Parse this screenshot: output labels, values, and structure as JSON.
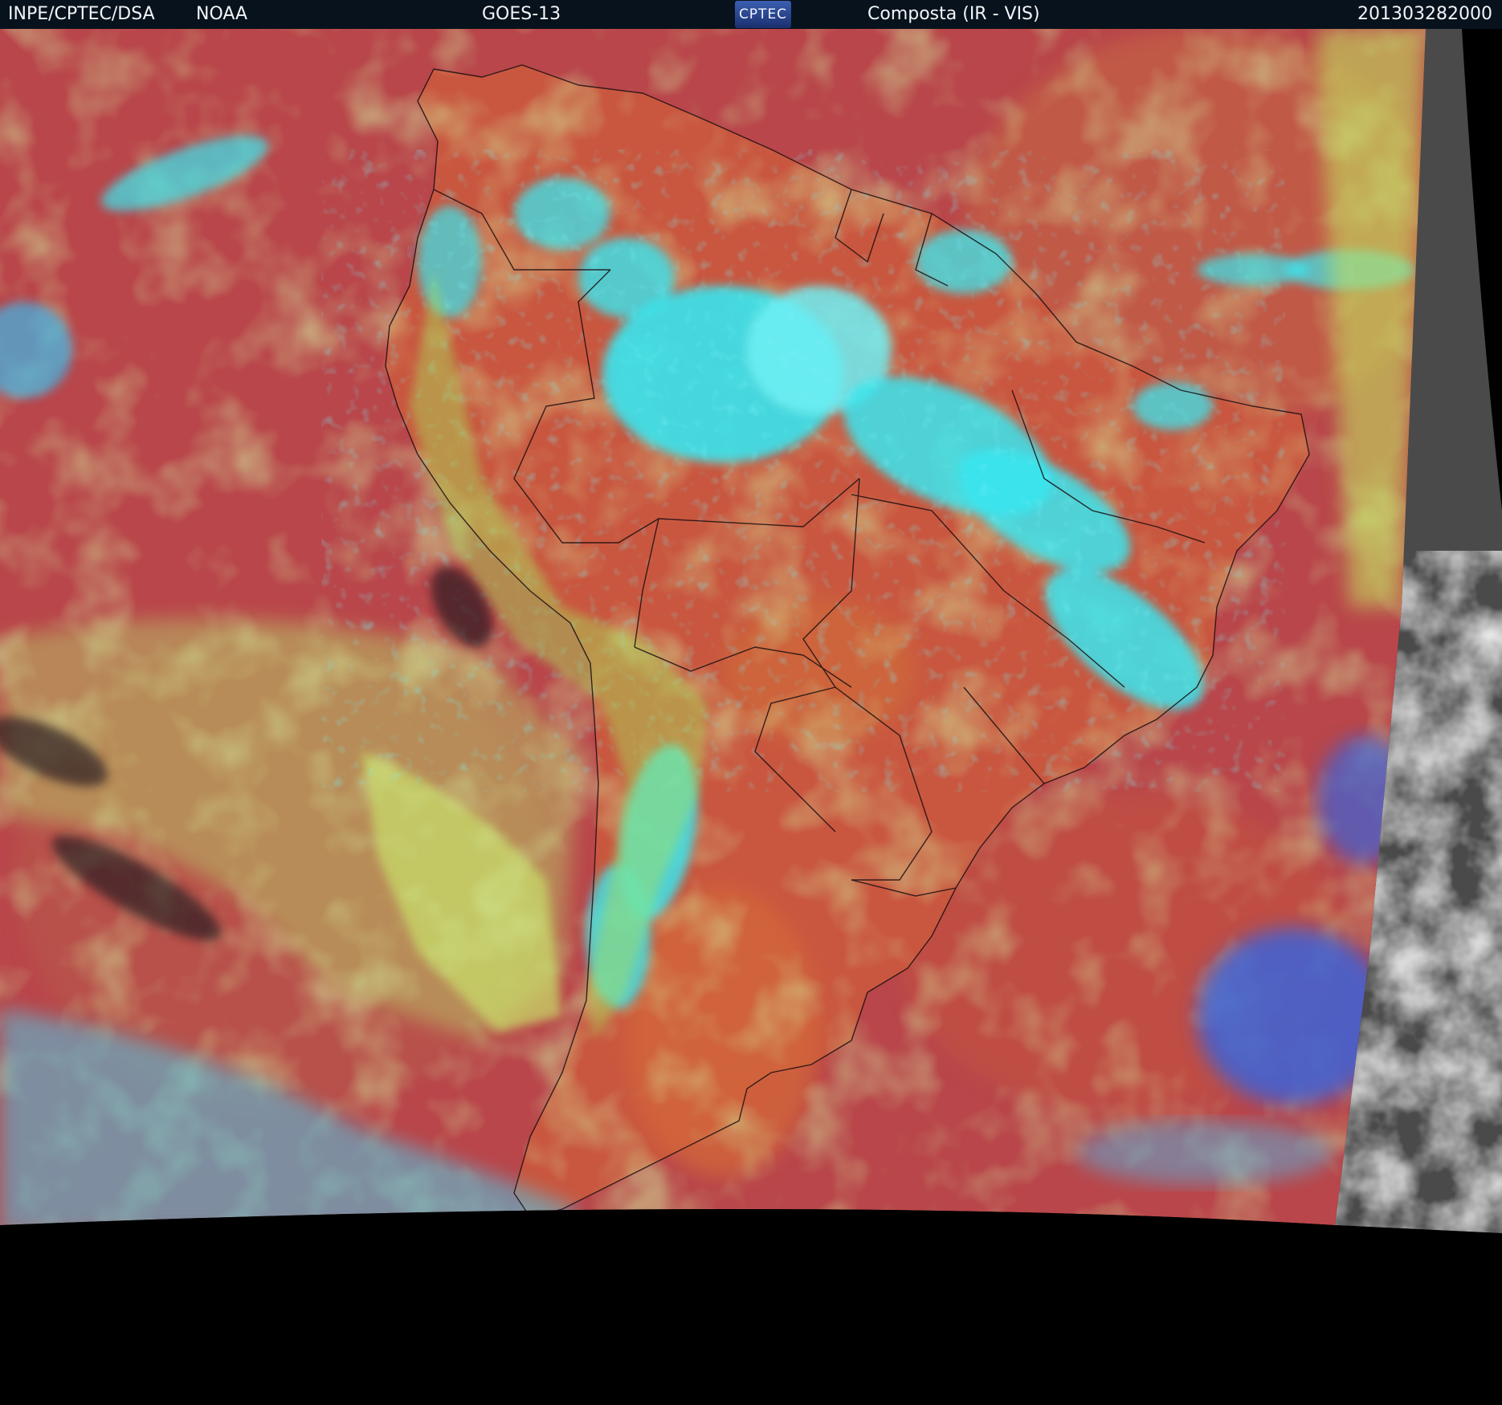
{
  "header": {
    "source_left": "INPE/CPTEC/DSA",
    "source_noaa": "NOAA",
    "satellite": "GOES-13",
    "logo_text": "CPTEC",
    "product": "Composta (IR - VIS)",
    "timestamp": "201303282000"
  },
  "colors": {
    "ocean_base": "#b9464a",
    "land_base": "#c9573f",
    "deep_convection": "#39e6f0",
    "mid_cloud": "#a9e05a",
    "low_cloud": "#3d63d8",
    "header_bg": "#07121c",
    "vis_gray": "#8b8b8b",
    "space": "#000000"
  },
  "map": {
    "region": "South America",
    "overlays": [
      "country-borders",
      "state-borders"
    ]
  }
}
